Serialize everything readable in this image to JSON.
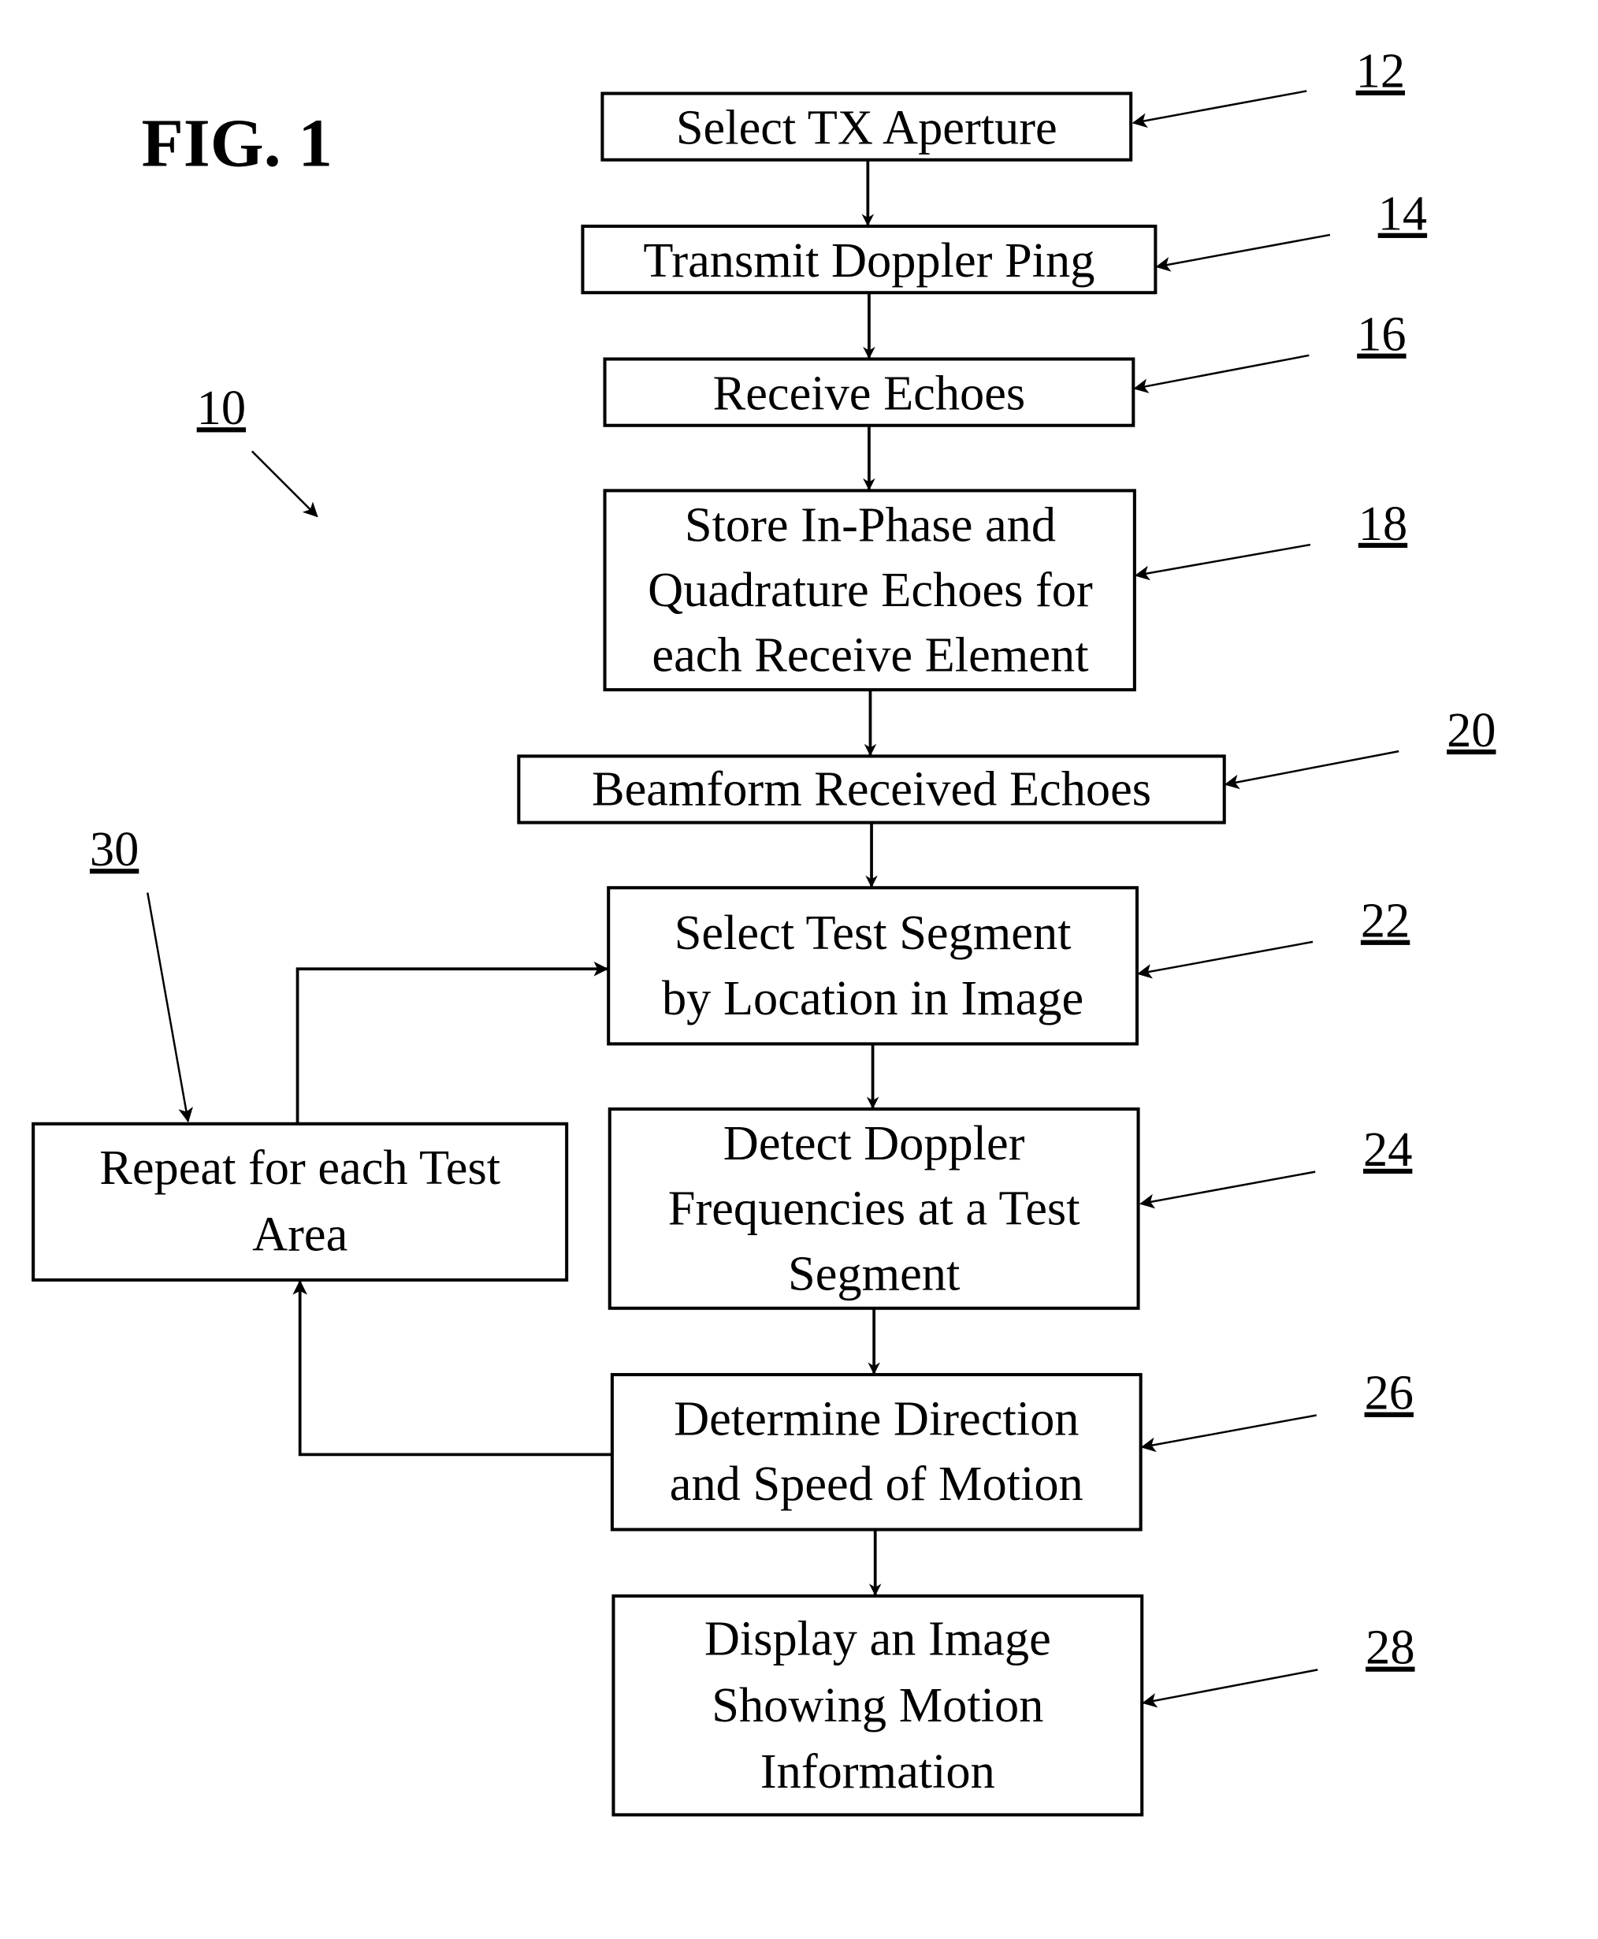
{
  "figure": {
    "title": "FIG. 1",
    "overall_ref": "10"
  },
  "steps": [
    {
      "ref": "12",
      "lines": [
        "Select TX Aperture"
      ]
    },
    {
      "ref": "14",
      "lines": [
        "Transmit Doppler Ping"
      ]
    },
    {
      "ref": "16",
      "lines": [
        "Receive Echoes"
      ]
    },
    {
      "ref": "18",
      "lines": [
        "Store In-Phase and",
        "Quadrature Echoes for",
        "each Receive Element"
      ]
    },
    {
      "ref": "20",
      "lines": [
        "Beamform Received Echoes"
      ]
    },
    {
      "ref": "22",
      "lines": [
        "Select Test Segment",
        "by Location in Image"
      ]
    },
    {
      "ref": "24",
      "lines": [
        "Detect Doppler",
        "Frequencies at a Test",
        "Segment"
      ]
    },
    {
      "ref": "26",
      "lines": [
        "Determine Direction",
        "and Speed of Motion"
      ]
    },
    {
      "ref": "28",
      "lines": [
        "Display an Image",
        "Showing Motion",
        "Information"
      ]
    }
  ],
  "loop": {
    "ref": "30",
    "lines": [
      "Repeat for each Test",
      "Area"
    ]
  }
}
